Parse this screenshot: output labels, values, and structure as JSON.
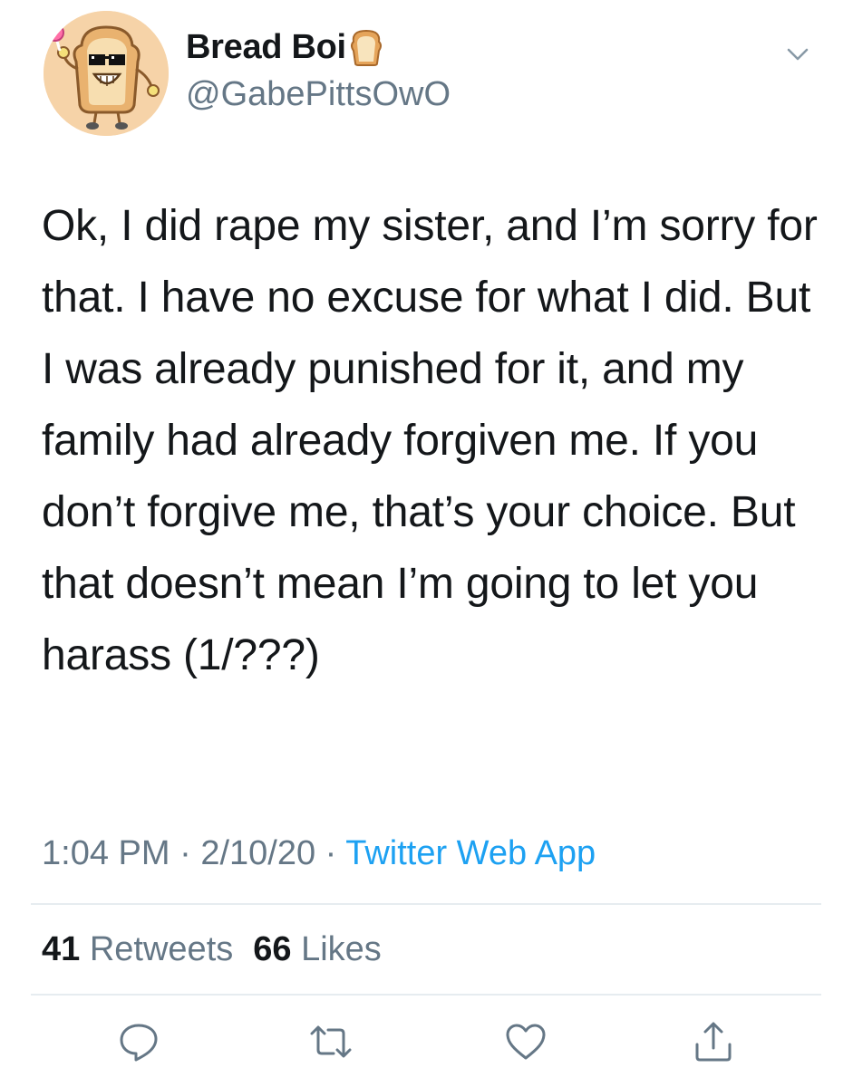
{
  "tweet": {
    "author": {
      "display_name": "Bread Boi",
      "name_emoji_icon": "bread-emoji-icon",
      "handle": "@GabePittsOwO",
      "avatar_icon": "bread-cartoon-avatar"
    },
    "menu_icon": "chevron-down-icon",
    "text": "Ok, I did rape my sister, and I’m sorry for that. I have no excuse for what I did. But I was already punished for it, and my family had already forgiven me. If you don’t forgive me, that’s your choice. But that doesn’t mean I’m going to let you harass (1/???)",
    "meta": {
      "time": "1:04 PM",
      "separator": " · ",
      "date": "2/10/20",
      "source": "Twitter Web App"
    },
    "stats": {
      "retweets_count": "41",
      "retweets_label": "Retweets",
      "likes_count": "66",
      "likes_label": "Likes"
    },
    "actions": [
      "reply-icon",
      "retweet-icon",
      "like-icon",
      "share-icon"
    ]
  },
  "colors": {
    "text_primary": "#14171a",
    "text_secondary": "#657786",
    "link": "#1da1f2",
    "divider": "#e6ecf0",
    "avatar_bg": "#f6d3a8"
  }
}
